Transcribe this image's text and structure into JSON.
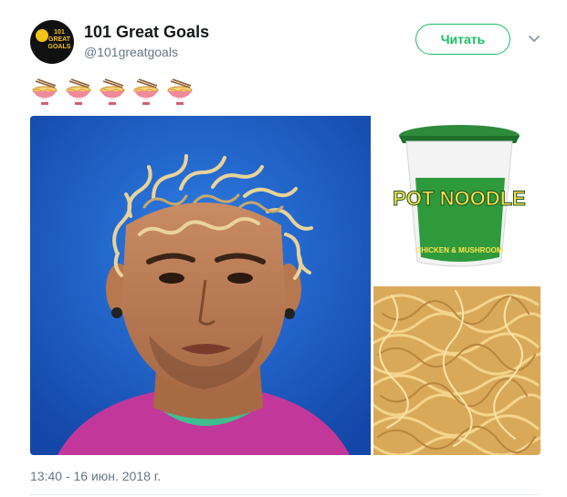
{
  "author": {
    "name": "101 Great Goals",
    "handle": "@101greatgoals",
    "avatar_text": "101 GREAT GOALS"
  },
  "follow_button": {
    "label": "Читать"
  },
  "menu": {
    "icon": "chevron-down-icon"
  },
  "tweet_text": {
    "emoji": [
      "ramen",
      "ramen",
      "ramen",
      "ramen",
      "ramen"
    ]
  },
  "media": {
    "images": [
      {
        "name": "player-photo",
        "description_icon": "photo"
      },
      {
        "name": "pot-noodle-cup",
        "brand_text": "POT NOODLE",
        "flavor_text": "CHICKEN & MUSHROOM"
      },
      {
        "name": "noodles-photo"
      }
    ]
  },
  "timestamp": "13:40 - 16 июн. 2018 г.",
  "colors": {
    "follow_green": "#17bf63",
    "secondary_text": "#657786",
    "divider": "#e6ecf0"
  }
}
